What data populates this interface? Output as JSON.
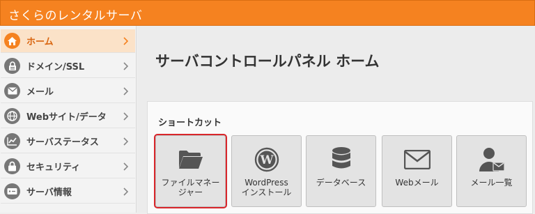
{
  "header": {
    "brand": "さくらのレンタルサーバ"
  },
  "sidebar": {
    "items": [
      {
        "label": "ホーム",
        "icon": "home-icon",
        "active": true
      },
      {
        "label": "ドメイン/SSL",
        "icon": "domain-lock-icon"
      },
      {
        "label": "メール",
        "icon": "mail-icon"
      },
      {
        "label": "Webサイト/データ",
        "icon": "globe-icon"
      },
      {
        "label": "サーバステータス",
        "icon": "chart-icon"
      },
      {
        "label": "セキュリティ",
        "icon": "lock-icon"
      },
      {
        "label": "サーバ情報",
        "icon": "server-icon"
      }
    ]
  },
  "main": {
    "title": "サーバコントロールパネル ホーム",
    "shortcuts": {
      "heading": "ショートカット",
      "tiles": [
        {
          "label": "ファイルマネー\nジャー",
          "icon": "folder-icon",
          "selected": true
        },
        {
          "label": "WordPress\nインストール",
          "icon": "wordpress-icon"
        },
        {
          "label": "データベース",
          "icon": "database-icon"
        },
        {
          "label": "Webメール",
          "icon": "envelope-icon"
        },
        {
          "label": "メール一覧",
          "icon": "user-mail-icon"
        }
      ]
    }
  },
  "colors": {
    "brand": "#f58220",
    "highlight": "#d9262b",
    "active_bg": "#fbe2c8"
  }
}
